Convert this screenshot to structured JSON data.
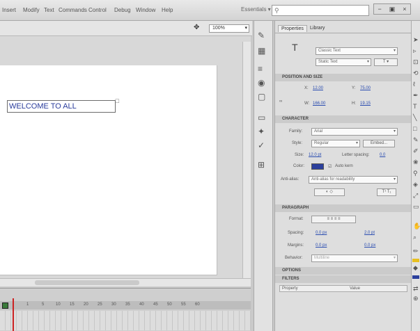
{
  "menubar": {
    "items": [
      "Insert",
      "Modify",
      "Text",
      "Commands",
      "Control",
      "Debug",
      "Window",
      "Help"
    ],
    "workspace": "Essentials ▾",
    "window_buttons": [
      "−",
      "▣",
      "×"
    ]
  },
  "toolbar": {
    "zoom": "100%"
  },
  "stage": {
    "text": "WELCOME TO ALL"
  },
  "timeline": {
    "frames": [
      "1",
      "5",
      "10",
      "15",
      "20",
      "25",
      "30",
      "35",
      "40",
      "45",
      "50",
      "55",
      "60"
    ]
  },
  "panel": {
    "tabs": [
      "Properties",
      "Library"
    ],
    "instance_type": "Classic Text",
    "text_type": "Static Text",
    "position_header": "POSITION AND SIZE",
    "x_label": "X:",
    "x_value": "12.00",
    "y_label": "Y:",
    "y_value": "75.00",
    "w_label": "W:",
    "w_value": "166.00",
    "h_label": "H:",
    "h_value": "19.15",
    "character_header": "CHARACTER",
    "family_label": "Family:",
    "family_value": "Arial",
    "style_label": "Style:",
    "style_value": "Regular",
    "embed_label": "Embed...",
    "size_label": "Size:",
    "size_value": "12.0 pt",
    "spacing_label": "Letter spacing:",
    "spacing_value": "0.0",
    "color_label": "Color:",
    "kerning_label": "Auto kern",
    "antialias_label": "Anti-alias:",
    "antialias_value": "Anti-alias for readability",
    "paragraph_header": "PARAGRAPH",
    "format_label": "Format:",
    "spacing2_label": "Spacing:",
    "indent_value": "0.0 px",
    "line_value": "2.0 pt",
    "margins_label": "Margins:",
    "left_margin": "0.0 px",
    "right_margin": "0.0 px",
    "behavior_label": "Behavior:",
    "behavior_value": "Multiline",
    "options_header": "OPTIONS",
    "filters_header": "FILTERS",
    "filters_cols": [
      "Property",
      "Value"
    ]
  }
}
